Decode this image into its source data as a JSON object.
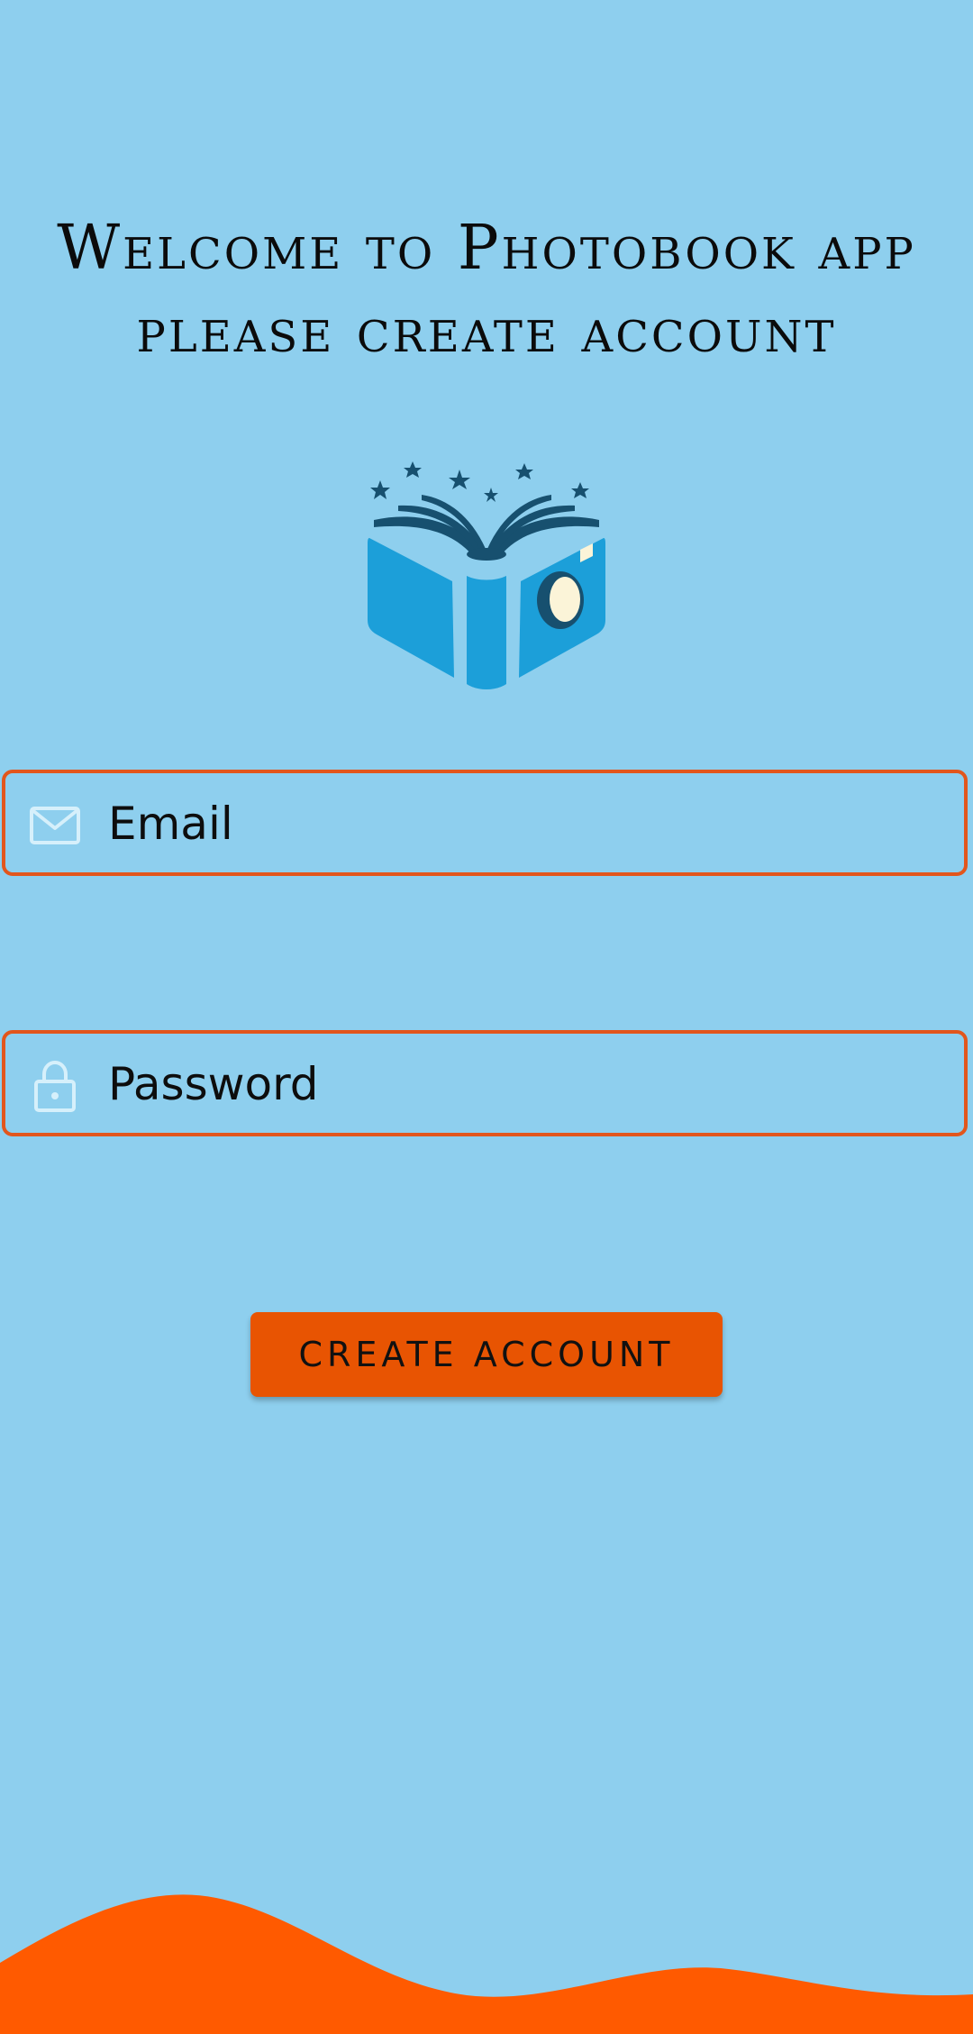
{
  "header": {
    "line1": "Welcome to Photobook app",
    "line2": "please create account"
  },
  "form": {
    "email_label": "Email",
    "password_label": "Password",
    "submit_label": "CREATE ACCOUNT"
  },
  "icons": {
    "logo": "photobook-logo-icon",
    "email": "mail-icon",
    "password": "lock-icon"
  },
  "colors": {
    "background": "#8ecfee",
    "accent": "#e85402",
    "field_border": "#e2561c",
    "wave": "#ff5a00",
    "logo_blue": "#1c9fd9",
    "logo_dark": "#17506f"
  }
}
